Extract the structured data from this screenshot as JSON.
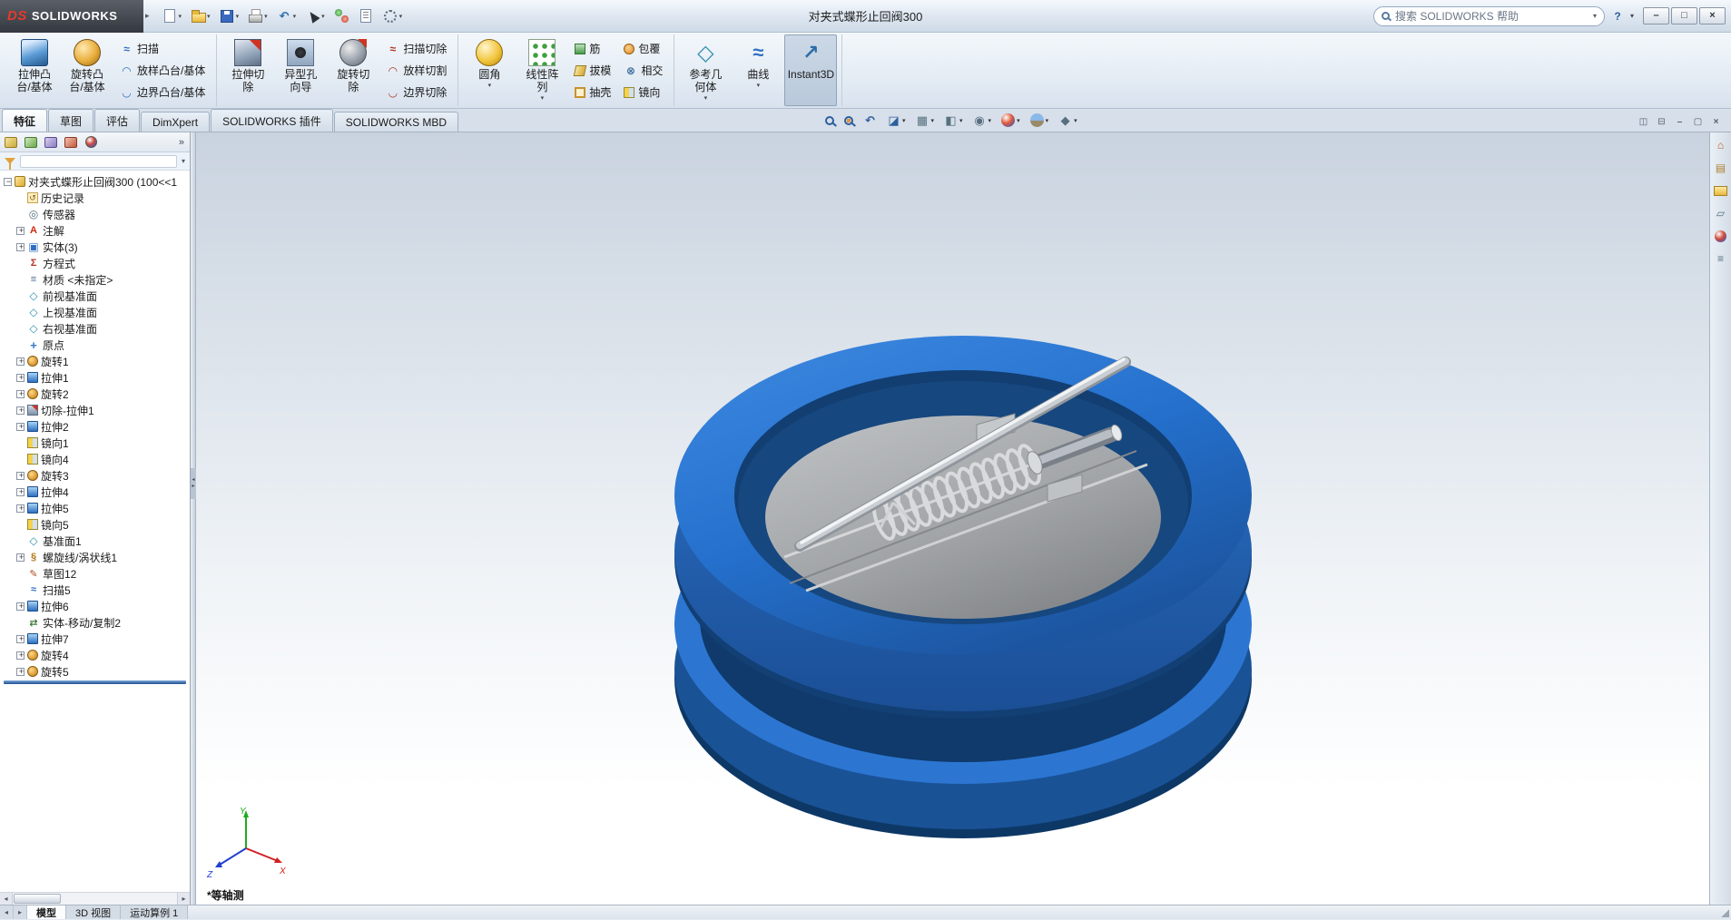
{
  "titlebar": {
    "logo": "DS",
    "brand": "SOLIDWORKS",
    "title": "对夹式蝶形止回阀300",
    "search_placeholder": "搜索 SOLIDWORKS 帮助",
    "help": "?"
  },
  "quick_access": [
    {
      "icon": "new-doc-icon",
      "dropdown": true
    },
    {
      "icon": "open-icon",
      "dropdown": true
    },
    {
      "icon": "save-icon",
      "dropdown": true
    },
    {
      "icon": "print-icon",
      "dropdown": true
    },
    {
      "icon": "undo-icon",
      "dropdown": true
    },
    {
      "icon": "select-icon",
      "dropdown": true
    },
    {
      "icon": "rebuild-icon"
    },
    {
      "icon": "file-properties-icon"
    },
    {
      "icon": "options-icon",
      "dropdown": true
    }
  ],
  "window_controls": [
    {
      "icon": "minimize-icon"
    },
    {
      "icon": "maximize-icon"
    },
    {
      "icon": "close-icon"
    }
  ],
  "ribbon": {
    "g1": {
      "big1": {
        "l1": "拉伸凸",
        "l2": "台/基体"
      },
      "big2": {
        "l1": "旋转凸",
        "l2": "台/基体"
      },
      "stack": [
        {
          "label": "扫描",
          "icon": "sweep-icon"
        },
        {
          "label": "放样凸台/基体",
          "icon": "loft-icon"
        },
        {
          "label": "边界凸台/基体",
          "icon": "boundary-icon"
        }
      ]
    },
    "g2": {
      "big1": {
        "l1": "拉伸切",
        "l2": "除"
      },
      "big2": {
        "l1": "异型孔",
        "l2": "向导"
      },
      "big3": {
        "l1": "旋转切",
        "l2": "除"
      },
      "stack": [
        {
          "label": "扫描切除",
          "icon": "sweep-cut-icon"
        },
        {
          "label": "放样切割",
          "icon": "loft-cut-icon"
        },
        {
          "label": "边界切除",
          "icon": "boundary-cut-icon"
        }
      ]
    },
    "g3": {
      "big1": {
        "l1": "圆角",
        "l2": ""
      },
      "big2": {
        "l1": "线性阵",
        "l2": "列"
      },
      "stackA": [
        {
          "label": "筋",
          "icon": "rib-icon"
        },
        {
          "label": "拔模",
          "icon": "draft-icon"
        },
        {
          "label": "抽壳",
          "icon": "shell-icon"
        }
      ],
      "stackB": [
        {
          "label": "包覆",
          "icon": "wrap-icon"
        },
        {
          "label": "相交",
          "icon": "intersect-icon"
        },
        {
          "label": "镜向",
          "icon": "mirror-small-icon"
        }
      ]
    },
    "g4": {
      "big1": {
        "l1": "参考几",
        "l2": "何体"
      },
      "big2": {
        "l1": "曲线",
        "l2": ""
      },
      "big3": {
        "l1": "Instant3D",
        "l2": ""
      }
    },
    "tabs": [
      {
        "label": "特征",
        "active": true
      },
      {
        "label": "草图"
      },
      {
        "label": "评估"
      },
      {
        "label": "DimXpert"
      },
      {
        "label": "SOLIDWORKS 插件"
      },
      {
        "label": "SOLIDWORKS MBD"
      }
    ]
  },
  "headsup": [
    {
      "icon": "zoom-fit-icon"
    },
    {
      "icon": "zoom-area-icon"
    },
    {
      "icon": "previous-view-icon"
    },
    {
      "icon": "section-view-icon",
      "dropdown": true
    },
    {
      "icon": "view-orientation-icon",
      "dropdown": true
    },
    {
      "icon": "display-style-icon",
      "dropdown": true
    },
    {
      "icon": "hide-show-icon",
      "dropdown": true
    },
    {
      "icon": "edit-appearance-icon",
      "dropdown": true
    },
    {
      "icon": "apply-scene-icon",
      "dropdown": true
    },
    {
      "icon": "view-settings-icon",
      "dropdown": true
    }
  ],
  "doc_controls": [
    {
      "icon": "pane-left-icon"
    },
    {
      "icon": "pane-split-icon"
    },
    {
      "icon": "doc-minimize-icon"
    },
    {
      "icon": "doc-restore-icon"
    },
    {
      "icon": "doc-close-icon"
    }
  ],
  "tree_tabs": [
    {
      "icon": "featuremanager-icon"
    },
    {
      "icon": "propertymanager-icon"
    },
    {
      "icon": "configurationmanager-icon"
    },
    {
      "icon": "dimxpertmanager-icon"
    },
    {
      "icon": "displaymanager-icon"
    }
  ],
  "tree_tabs_more": "»",
  "feature_tree": {
    "root": {
      "label": "对夹式蝶形止回阀300 (100<<1",
      "icon": "part-icon"
    },
    "items": [
      {
        "label": "历史记录",
        "icon": "history-icon"
      },
      {
        "label": "传感器",
        "icon": "sensors-icon"
      },
      {
        "label": "注解",
        "icon": "annotations-icon",
        "expand": true
      },
      {
        "label": "实体(3)",
        "icon": "solids-icon",
        "expand": true
      },
      {
        "label": "方程式",
        "icon": "equations-icon"
      },
      {
        "label": "材质 <未指定>",
        "icon": "material-icon"
      },
      {
        "label": "前视基准面",
        "icon": "plane-icon"
      },
      {
        "label": "上视基准面",
        "icon": "plane-icon"
      },
      {
        "label": "右视基准面",
        "icon": "plane-icon"
      },
      {
        "label": "原点",
        "icon": "origin-icon"
      },
      {
        "label": "旋转1",
        "icon": "revolve-icon",
        "expand": true
      },
      {
        "label": "拉伸1",
        "icon": "extrude-icon",
        "expand": true
      },
      {
        "label": "旋转2",
        "icon": "revolve-icon",
        "expand": true
      },
      {
        "label": "切除-拉伸1",
        "icon": "cut-extrude-icon",
        "expand": true
      },
      {
        "label": "拉伸2",
        "icon": "extrude-icon",
        "expand": true
      },
      {
        "label": "镜向1",
        "icon": "mirror-icon"
      },
      {
        "label": "镜向4",
        "icon": "mirror-icon"
      },
      {
        "label": "旋转3",
        "icon": "revolve-icon",
        "expand": true
      },
      {
        "label": "拉伸4",
        "icon": "extrude-icon",
        "expand": true
      },
      {
        "label": "拉伸5",
        "icon": "extrude-icon",
        "expand": true
      },
      {
        "label": "镜向5",
        "icon": "mirror-icon"
      },
      {
        "label": "基准面1",
        "icon": "plane-icon"
      },
      {
        "label": "螺旋线/涡状线1",
        "icon": "helix-icon",
        "expand": true
      },
      {
        "label": "草图12",
        "icon": "sketch-icon"
      },
      {
        "label": "扫描5",
        "icon": "sweep-feature-icon"
      },
      {
        "label": "拉伸6",
        "icon": "extrude-icon",
        "expand": true
      },
      {
        "label": "实体-移动/复制2",
        "icon": "move-copy-icon"
      },
      {
        "label": "拉伸7",
        "icon": "extrude-icon",
        "expand": true
      },
      {
        "label": "旋转4",
        "icon": "revolve-icon",
        "expand": true
      },
      {
        "label": "旋转5",
        "icon": "revolve-icon",
        "expand": true
      }
    ]
  },
  "viewport": {
    "view_label": "*等轴测",
    "triad": {
      "x": "X",
      "y": "Y",
      "z": "Z"
    },
    "model_colors": {
      "body_blue": "#2273d0",
      "disc_gray": "#9b9ea1",
      "rod_silver": "#d9dcdf"
    }
  },
  "task_pane": [
    {
      "icon": "resources-icon"
    },
    {
      "icon": "design-library-icon"
    },
    {
      "icon": "file-explorer-icon"
    },
    {
      "icon": "view-palette-icon"
    },
    {
      "icon": "appearances-icon"
    },
    {
      "icon": "custom-properties-icon"
    }
  ],
  "statusbar": {
    "tabs": [
      {
        "label": "模型",
        "active": true
      },
      {
        "label": "3D 视图"
      },
      {
        "label": "运动算例 1"
      }
    ]
  }
}
